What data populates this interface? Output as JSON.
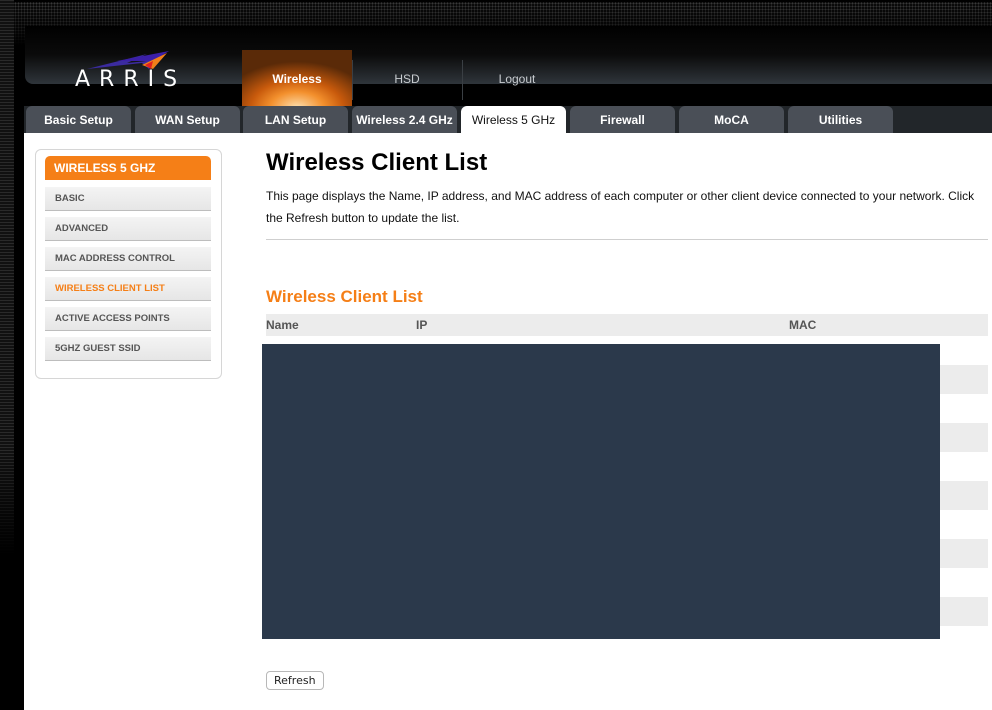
{
  "brand": {
    "logo_text": "ARRIS"
  },
  "topnav": {
    "items": [
      {
        "label": "Wireless",
        "active": true
      },
      {
        "label": "HSD",
        "active": false
      },
      {
        "label": "Logout",
        "active": false
      }
    ]
  },
  "tabs": [
    {
      "label": "Basic Setup",
      "active": false
    },
    {
      "label": "WAN Setup",
      "active": false
    },
    {
      "label": "LAN Setup",
      "active": false
    },
    {
      "label": "Wireless 2.4 GHz",
      "active": false
    },
    {
      "label": "Wireless 5 GHz",
      "active": true
    },
    {
      "label": "Firewall",
      "active": false
    },
    {
      "label": "MoCA",
      "active": false
    },
    {
      "label": "Utilities",
      "active": false
    }
  ],
  "sidebar": {
    "title": "WIRELESS 5 GHZ",
    "items": [
      {
        "label": "BASIC",
        "active": false
      },
      {
        "label": "ADVANCED",
        "active": false
      },
      {
        "label": "MAC ADDRESS CONTROL",
        "active": false
      },
      {
        "label": "WIRELESS CLIENT LIST",
        "active": true
      },
      {
        "label": "ACTIVE ACCESS POINTS",
        "active": false
      },
      {
        "label": "5GHZ GUEST SSID",
        "active": false
      }
    ]
  },
  "main": {
    "title": "Wireless Client List",
    "description": "This page displays the Name, IP address, and MAC address of each computer or other client device connected to your network. Click the Refresh button to update the list.",
    "section_title": "Wireless Client List",
    "table": {
      "columns": [
        "Name",
        "IP",
        "MAC"
      ],
      "rows_redacted": true
    },
    "refresh_label": "Refresh"
  },
  "colors": {
    "accent": "#f57f17",
    "tab_bg": "#4a4f57",
    "redaction": "#2b394b"
  }
}
